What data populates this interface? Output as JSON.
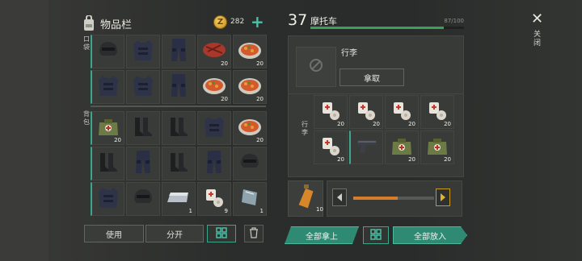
{
  "inventory": {
    "title": "物品栏",
    "coins": "282",
    "plus": "+",
    "pocket_label": "口袋",
    "backpack_label": "背包",
    "pocket_items": [
      {
        "icon": "helmet-icon",
        "count": ""
      },
      {
        "icon": "vest-icon",
        "count": ""
      },
      {
        "icon": "pants-icon",
        "count": ""
      },
      {
        "icon": "steak-icon",
        "count": "20"
      },
      {
        "icon": "stew-icon",
        "count": "20"
      },
      {
        "icon": "vest-icon",
        "count": ""
      },
      {
        "icon": "vest-icon",
        "count": ""
      },
      {
        "icon": "pants-icon",
        "count": ""
      },
      {
        "icon": "stew-icon",
        "count": "20"
      },
      {
        "icon": "stew-icon",
        "count": "20"
      }
    ],
    "backpack_items": [
      {
        "icon": "medbag-icon",
        "count": "20"
      },
      {
        "icon": "boots-icon",
        "count": ""
      },
      {
        "icon": "boots-icon",
        "count": ""
      },
      {
        "icon": "vest-icon",
        "count": ""
      },
      {
        "icon": "stew-icon",
        "count": "20"
      },
      {
        "icon": "boots-icon",
        "count": ""
      },
      {
        "icon": "pants-icon",
        "count": ""
      },
      {
        "icon": "boots-icon",
        "count": ""
      },
      {
        "icon": "pants-icon",
        "count": ""
      },
      {
        "icon": "helmet-icon",
        "count": ""
      },
      {
        "icon": "vest-icon",
        "count": ""
      },
      {
        "icon": "helmet-icon",
        "count": ""
      },
      {
        "icon": "ingot-icon",
        "count": "1"
      },
      {
        "icon": "bandage-icon",
        "count": "9"
      },
      {
        "icon": "glass-icon",
        "count": "1"
      }
    ],
    "use_label": "使用",
    "split_label": "分开"
  },
  "vehicle": {
    "level": "37",
    "name": "摩托车",
    "hp_text": "87/100",
    "hp_fraction": 0.87,
    "luggage_title": "行李",
    "take_label": "拿取",
    "luggage_side_label": "行李",
    "luggage_items": [
      {
        "icon": "bandage-icon",
        "count": "20"
      },
      {
        "icon": "bandage-icon",
        "count": "20"
      },
      {
        "icon": "bandage-icon",
        "count": "20"
      },
      {
        "icon": "bandage-icon",
        "count": "20"
      },
      {
        "icon": "bandage-icon",
        "count": "20"
      },
      {
        "icon": "pistol-icon",
        "count": ""
      },
      {
        "icon": "medbag-icon",
        "count": "20"
      },
      {
        "icon": "medbag-icon",
        "count": "20"
      }
    ],
    "fuel_count": "10",
    "fuel_fraction": 0.55,
    "take_all_label": "全部拿上",
    "put_all_label": "全部放入"
  },
  "close_label": "关闭"
}
